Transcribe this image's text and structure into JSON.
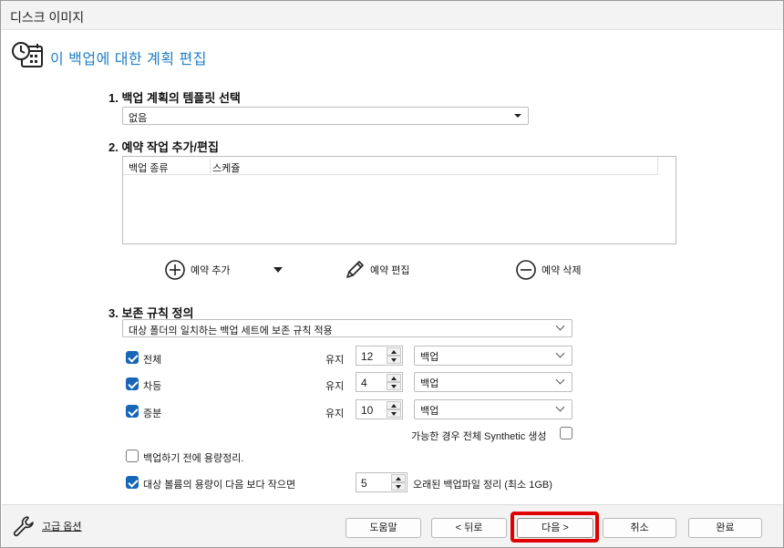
{
  "window": {
    "title": "디스크 이미지"
  },
  "header": {
    "title": "이 백업에 대한 계획 편집",
    "icon": "schedule-clock-icon"
  },
  "section1": {
    "label": "1. 백업 계획의 템플릿 선택",
    "template_value": "없음"
  },
  "section2": {
    "label": "2. 예약 작업 추가/편집",
    "columns": [
      "백업 종류",
      "스케쥴"
    ],
    "actions": {
      "add": "예약 추가",
      "edit": "예약 편집",
      "delete": "예약 삭제"
    }
  },
  "section3": {
    "label": "3. 보존 규칙 정의",
    "rule_select": "대상 폴더의 일치하는 백업 세트에 보존 규칙 적용",
    "rows": [
      {
        "label": "전체",
        "checked": true,
        "keep": "유지",
        "count": "12",
        "unit": "백업"
      },
      {
        "label": "차등",
        "checked": true,
        "keep": "유지",
        "count": "4",
        "unit": "백업"
      },
      {
        "label": "증분",
        "checked": true,
        "keep": "유지",
        "count": "10",
        "unit": "백업"
      }
    ],
    "synthetic_label": "가능한 경우 전체 Synthetic 생성",
    "synthetic_checked": false,
    "cleanup_label": "백업하기 전에 용량정리.",
    "cleanup_checked": false,
    "volume_label": "대상 볼륨의 용량이 다음 보다 작으면",
    "volume_checked": true,
    "volume_value": "5",
    "volume_suffix": "오래된 백업파일 정리 (최소 1GB)"
  },
  "footer": {
    "advanced": "고급 옵션",
    "help": "도움말",
    "back": "< 뒤로",
    "next": "다음 >",
    "cancel": "취소",
    "finish": "완료"
  },
  "colors": {
    "accent": "#1e7ec8",
    "checkbox": "#1866b8",
    "highlight": "#e00000"
  }
}
